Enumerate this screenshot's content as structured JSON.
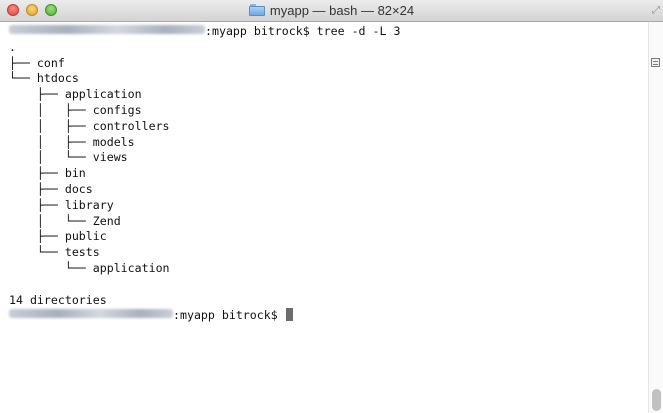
{
  "window": {
    "title": "myapp — bash — 82×24",
    "icons": {
      "title_icon": "folder-icon",
      "resize": "fullscreen-icon"
    }
  },
  "terminal": {
    "command_line": ":myapp bitrock$ tree -d -L 3",
    "tree_lines": [
      ".",
      "├── conf",
      "└── htdocs",
      "    ├── application",
      "    │   ├── configs",
      "    │   ├── controllers",
      "    │   ├── models",
      "    │   └── views",
      "    ├── bin",
      "    ├── docs",
      "    ├── library",
      "    │   └── Zend",
      "    ├── public",
      "    └── tests",
      "        └── application"
    ],
    "summary": "14 directories",
    "prompt": ":myapp bitrock$ "
  }
}
